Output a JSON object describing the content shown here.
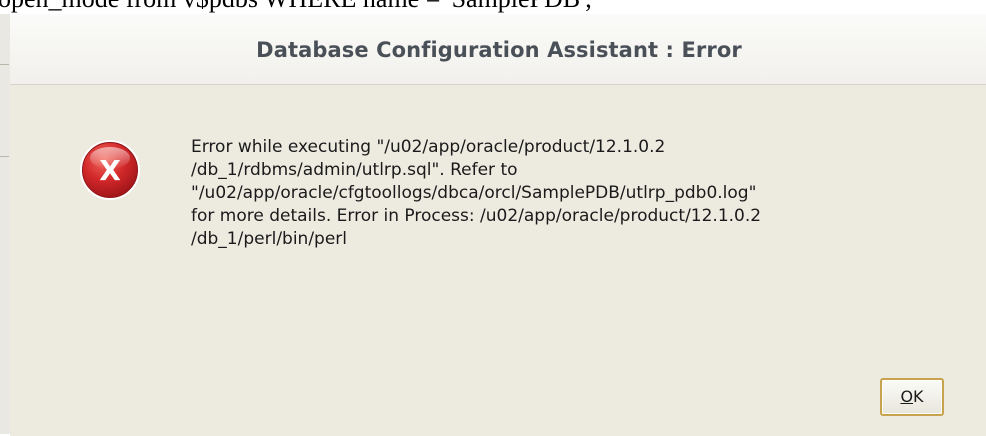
{
  "background": {
    "text": "open_mode from v$pdbs WHERE name = 'SamplePDB';"
  },
  "dialog": {
    "title": "Database Configuration Assistant : Error",
    "icon": "error-x-icon",
    "message_lines": [
      "Error while executing \"/u02/app/oracle/product/12.1.0.2",
      "/db_1/rdbms/admin/utlrp.sql\". Refer to",
      "\"/u02/app/oracle/cfgtoollogs/dbca/orcl/SamplePDB/utlrp_pdb0.log\"",
      "for more details. Error in Process: /u02/app/oracle/product/12.1.0.2",
      "/db_1/perl/bin/perl"
    ],
    "ok_button": {
      "mnemonic": "O",
      "rest": "K"
    }
  },
  "colors": {
    "dialog_bg": "#edeae0",
    "title_text": "#4a5058",
    "error_red": "#d2282a",
    "button_border": "#c8a24e"
  }
}
